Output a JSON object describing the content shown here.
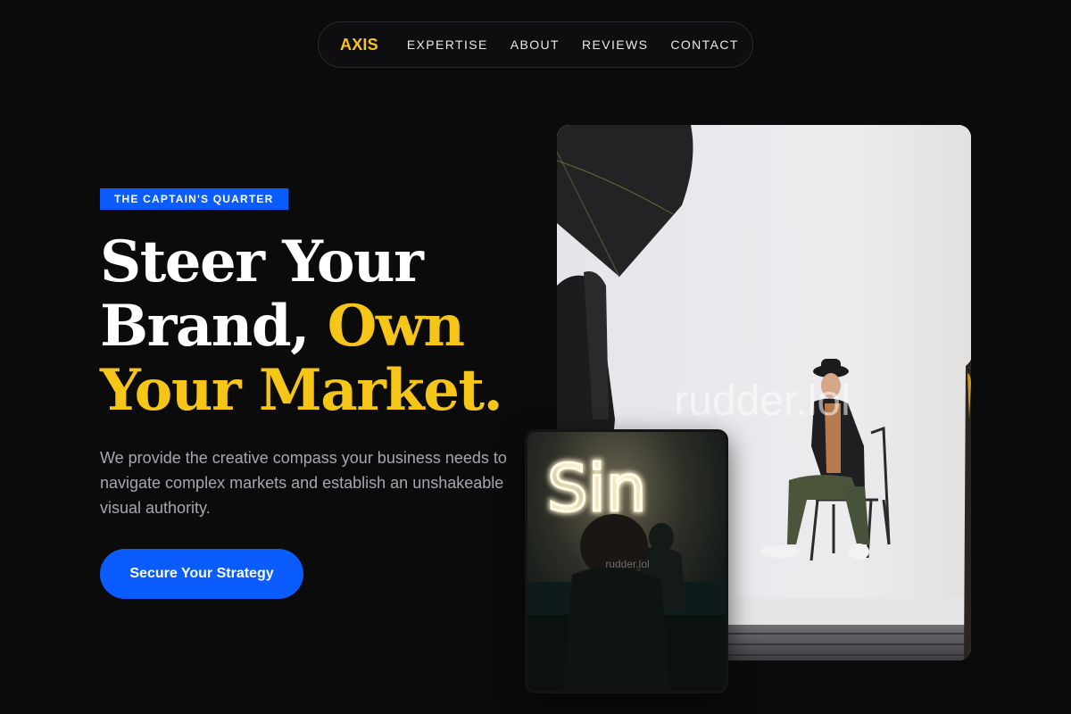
{
  "nav": {
    "logo": "AXIS",
    "links": [
      "EXPERTISE",
      "ABOUT",
      "REVIEWS",
      "CONTACT"
    ]
  },
  "hero": {
    "badge": "THE CAPTAIN'S QUARTER",
    "headline": {
      "line1": "Steer Your",
      "line2_plain": "Brand, ",
      "line2_accent": "Own",
      "line3_accent": "Your Market."
    },
    "lead": "We provide the creative compass your business needs to navigate complex markets and establish an unshakeable visual authority.",
    "cta": "Secure Your Strategy"
  },
  "images": {
    "main_watermark": "rudder.lol",
    "small_watermark": "rudder.lol",
    "neon_sign_text": "Sin"
  },
  "colors": {
    "background": "#0b0b0c",
    "accent_yellow": "#f5c518",
    "accent_blue": "#0a5cff",
    "body_text": "#a6a8b0"
  }
}
